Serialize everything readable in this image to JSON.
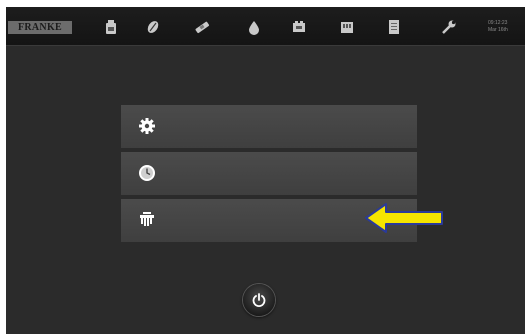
{
  "topbar": {
    "logo_text": "FRANKE",
    "icons": [
      "bottle-icon",
      "coffee-bean-icon",
      "cleaning-tablet-icon",
      "water-drop-icon",
      "milk-system-icon",
      "grounds-container-icon",
      "document-icon",
      "wrench-icon"
    ],
    "time": "09:12:23",
    "date": "Mar 16th"
  },
  "menu": {
    "items": [
      {
        "icon": "gear-icon"
      },
      {
        "icon": "clock-icon"
      },
      {
        "icon": "cleaning-hand-icon"
      }
    ]
  },
  "colors": {
    "arrow": "#f5e400",
    "arrow_border": "#2a3a9a"
  }
}
